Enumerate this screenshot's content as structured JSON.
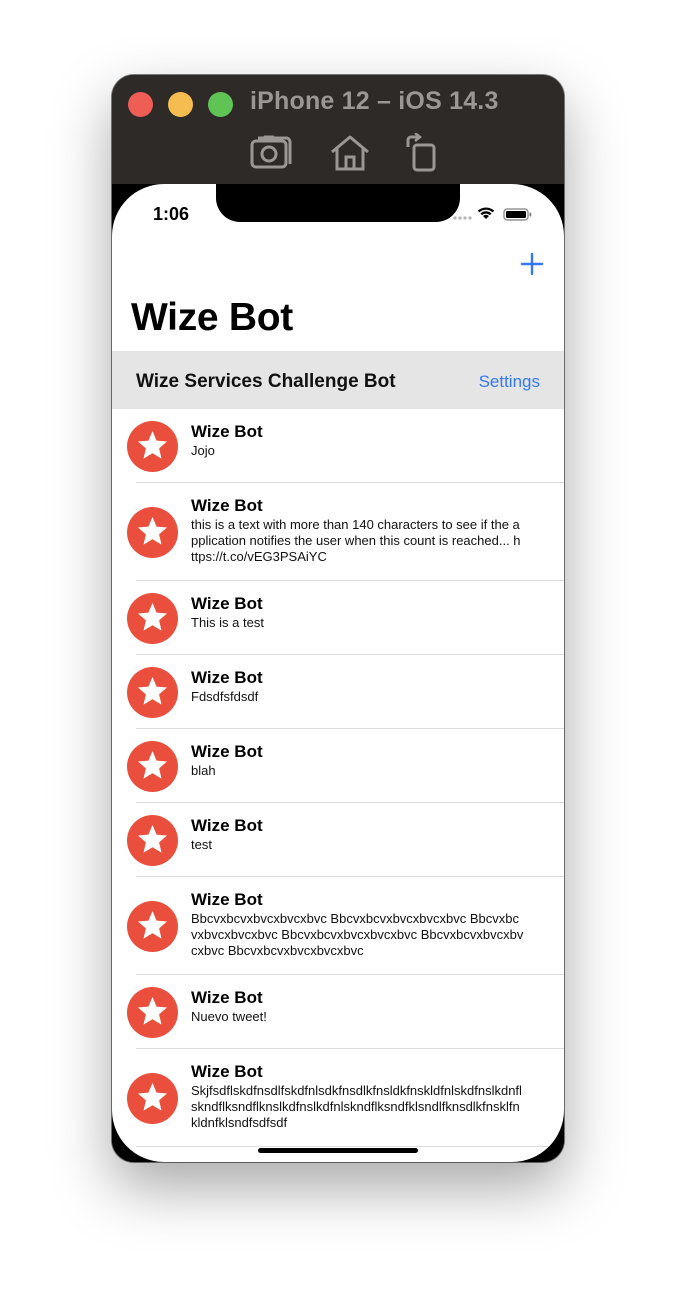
{
  "simulator": {
    "title": "iPhone 12 – iOS 14.3",
    "toolbar": [
      "screenshot-icon",
      "home-icon",
      "rotate-icon"
    ]
  },
  "status_bar": {
    "time": "1:06"
  },
  "nav": {
    "title": "Wize Bot",
    "add_icon": "plus-icon"
  },
  "section": {
    "title": "Wize Services Challenge Bot",
    "settings_label": "Settings"
  },
  "colors": {
    "accent": "#3478f6",
    "avatar": "#ea4f3d",
    "section_bg": "#e5e5e5"
  },
  "tweets": [
    {
      "name": "Wize Bot",
      "text": "Jojo"
    },
    {
      "name": "Wize Bot",
      "text": "this is a text with more than 140 characters to see if the application notifies the user when this count is reached... https://t.co/vEG3PSAiYC"
    },
    {
      "name": "Wize Bot",
      "text": "This is a test"
    },
    {
      "name": "Wize Bot",
      "text": "Fdsdfsfdsdf"
    },
    {
      "name": "Wize Bot",
      "text": "blah"
    },
    {
      "name": "Wize Bot",
      "text": "test"
    },
    {
      "name": "Wize Bot",
      "text": "Bbcvxbcvxbvcxbvcxbvc Bbcvxbcvxbvcxbvcxbvc Bbcvxbcvxbvcxbvcxbvc Bbcvxbcvxbvcxbvcxbvc Bbcvxbcvxbvcxbvcxbvc Bbcvxbcvxbvcxbvcxbvc"
    },
    {
      "name": "Wize Bot",
      "text": "Nuevo tweet!"
    },
    {
      "name": "Wize Bot",
      "text": "Skjfsdflskdfnsdlfskdfnlsdkfnsdlkfnsldkfnskldfnlskdfnslkdnflskndflksndflknslkdfnslkdfnlskndflksndfklsndlfknsdlkfnsklfnkldnfklsndfsdfsdf"
    }
  ]
}
